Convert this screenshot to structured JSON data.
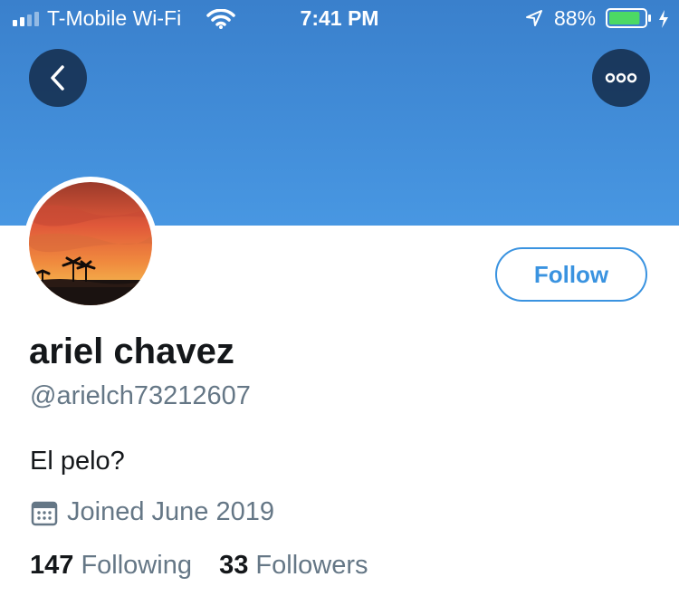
{
  "status_bar": {
    "carrier": "T-Mobile Wi-Fi",
    "time": "7:41 PM",
    "battery_percent": "88%",
    "battery_level": 0.88,
    "icons": [
      "signal-icon",
      "wifi-icon",
      "location-arrow-icon",
      "battery-icon",
      "charging-icon"
    ]
  },
  "header": {
    "back_icon": "chevron-left-icon",
    "more_icon": "more-dots-icon"
  },
  "profile": {
    "display_name": "ariel chavez",
    "handle": "@arielch73212607",
    "bio": "El pelo?",
    "joined": "Joined June 2019",
    "joined_icon": "calendar-icon",
    "follow_label": "Follow",
    "following_count": "147",
    "following_label": "Following",
    "followers_count": "33",
    "followers_label": "Followers"
  },
  "colors": {
    "banner": "#4897e2",
    "accent": "#3a93e0",
    "text": "#14171a",
    "secondary_text": "#657786",
    "battery": "#4cd964"
  }
}
